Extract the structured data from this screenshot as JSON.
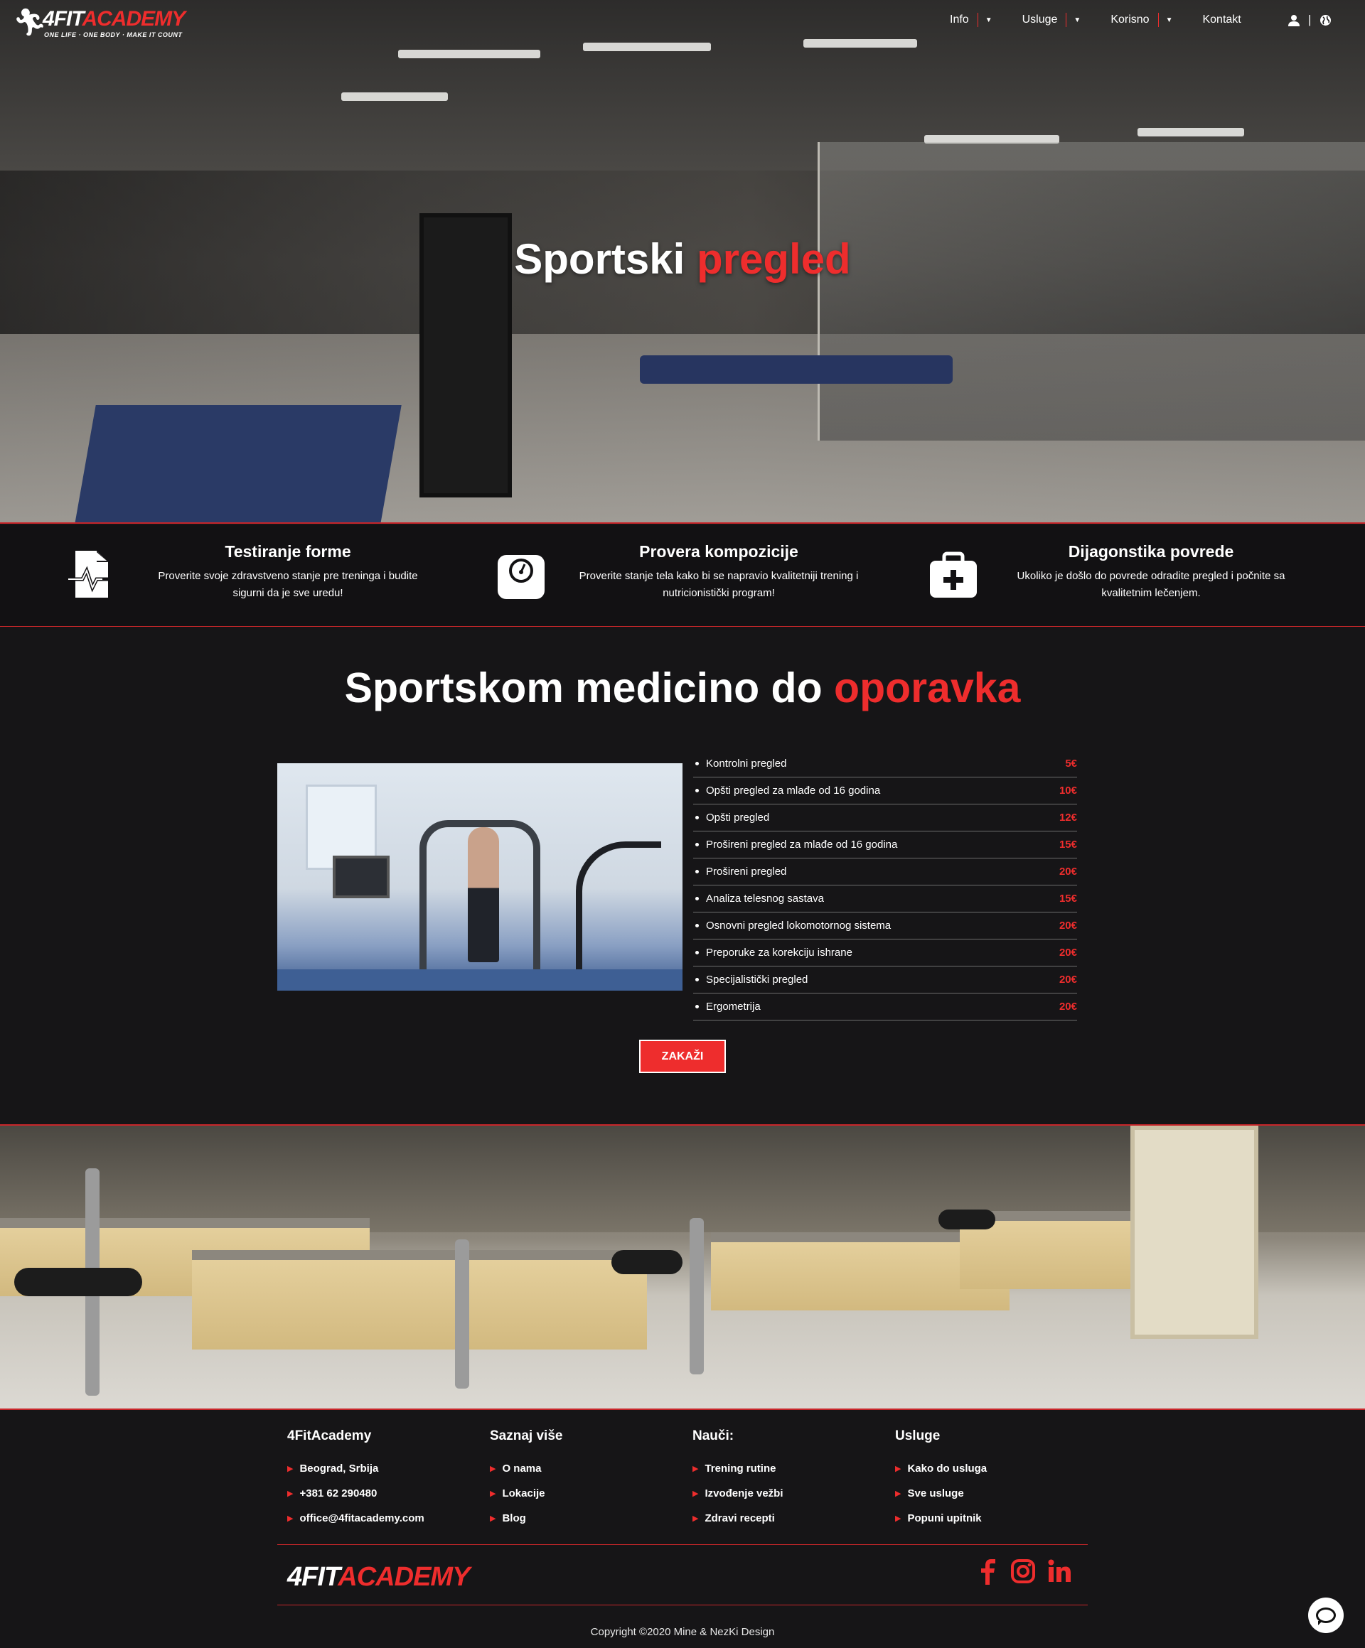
{
  "brand": {
    "name_white": "4FIT",
    "name_red": "ACADEMY",
    "tagline": "ONE LIFE · ONE BODY · MAKE IT COUNT"
  },
  "nav": {
    "items": [
      {
        "label": "Info",
        "has_dropdown": true
      },
      {
        "label": "Usluge",
        "has_dropdown": true
      },
      {
        "label": "Korisno",
        "has_dropdown": true
      },
      {
        "label": "Kontakt",
        "has_dropdown": false
      }
    ],
    "icons": [
      "user-icon",
      "globe-icon"
    ],
    "icon_separator": "|"
  },
  "hero": {
    "title_white": "Sportski",
    "title_red": "pregled"
  },
  "features": [
    {
      "icon": "medical-file-icon",
      "title": "Testiranje forme",
      "description": "Proverite svoje zdravstveno stanje pre treninga i budite sigurni da je sve uredu!"
    },
    {
      "icon": "scale-icon",
      "title": "Provera kompozicije",
      "description": "Proverite stanje tela kako bi se napravio kvalitetniji trening i nutricionistički program!"
    },
    {
      "icon": "first-aid-kit-icon",
      "title": "Dijagonstika povrede",
      "description": "Ukoliko je došlo do povrede odradite pregled i počnite sa kvalitetnim lečenjem."
    }
  ],
  "services": {
    "title_white": "Sportskom medicino do",
    "title_red": "oporavka",
    "items": [
      {
        "name": "Kontrolni pregled",
        "price": "5€"
      },
      {
        "name": "Opšti pregled za mlađe od 16 godina",
        "price": "10€"
      },
      {
        "name": "Opšti pregled",
        "price": "12€"
      },
      {
        "name": "Prošireni pregled za mlađe od 16 godina",
        "price": "15€"
      },
      {
        "name": "Prošireni pregled",
        "price": "20€"
      },
      {
        "name": "Analiza telesnog sastava",
        "price": "15€"
      },
      {
        "name": "Osnovni pregled lokomotornog sistema",
        "price": "20€"
      },
      {
        "name": "Preporuke za korekciju ishrane",
        "price": "20€"
      },
      {
        "name": "Specijalistički pregled",
        "price": "20€"
      },
      {
        "name": "Ergometrija",
        "price": "20€"
      }
    ],
    "cta_label": "ZAKAŽI"
  },
  "footer": {
    "columns": [
      {
        "title": "4FitAcademy",
        "links": [
          "Beograd, Srbija",
          "+381 62 290480",
          "office@4fitacademy.com"
        ]
      },
      {
        "title": "Saznaj više",
        "links": [
          "O nama",
          "Lokacije",
          "Blog"
        ]
      },
      {
        "title": "Nauči:",
        "links": [
          "Trening rutine",
          "Izvođenje vežbi",
          "Zdravi recepti"
        ]
      },
      {
        "title": "Usluge",
        "links": [
          "Kako do usluga",
          "Sve usluge",
          "Popuni upitnik"
        ]
      }
    ],
    "social": [
      "facebook-icon",
      "instagram-icon",
      "linkedin-icon"
    ],
    "copyright": "Copyright ©2020 Mine & NezKi Design"
  },
  "colors": {
    "accent": "#ee2d2d",
    "background": "#161517"
  }
}
